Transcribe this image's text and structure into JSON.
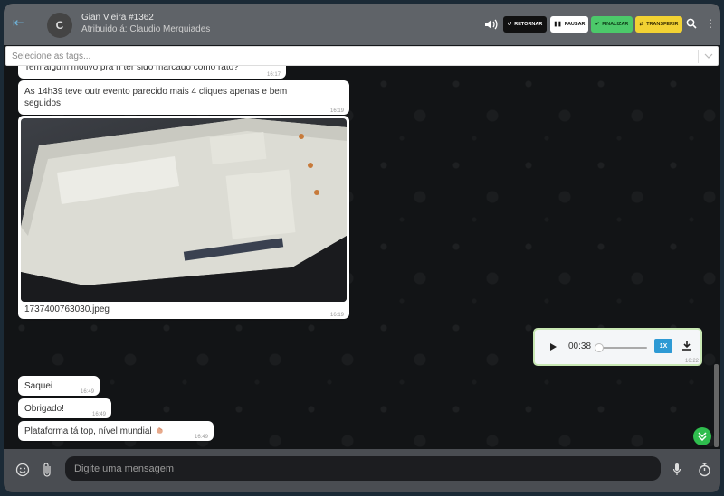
{
  "header": {
    "avatar_initial": "C",
    "contact_name": "Gian Vieira #1362",
    "assigned": "Atribuido á: Claudio Merquiades",
    "buttons": {
      "retornar": "RETORNAR",
      "pausar": "PAUSAR",
      "finalizar": "FINALIZAR",
      "transferir": "TRANSFERIR"
    }
  },
  "tags": {
    "placeholder": "Selecione as tags..."
  },
  "messages": [
    {
      "text": "Tem algum motivo pra ñ ter sido marcado como rato?",
      "time": "16:17"
    },
    {
      "text": "As 14h39 teve outr evento parecido mais 4 cliques apenas e bem seguidos",
      "time": "16:19"
    },
    {
      "filename": "1737400763030.jpeg",
      "time": "16:19"
    },
    {
      "text": "Saquei",
      "time": "16:49"
    },
    {
      "text": "Obrigado!",
      "time": "16:49"
    },
    {
      "text": "Plataforma tá top, nível mundial",
      "time": "16:49"
    }
  ],
  "audio": {
    "duration": "00:38",
    "speed": "1X",
    "time": "16:22",
    "progress": 0
  },
  "composer": {
    "placeholder": "Digite uma mensagem"
  },
  "colors": {
    "header": "#5f6368",
    "finalizar": "#4cc96a",
    "transferir": "#f2d233",
    "accent": "#2e9ad4"
  }
}
